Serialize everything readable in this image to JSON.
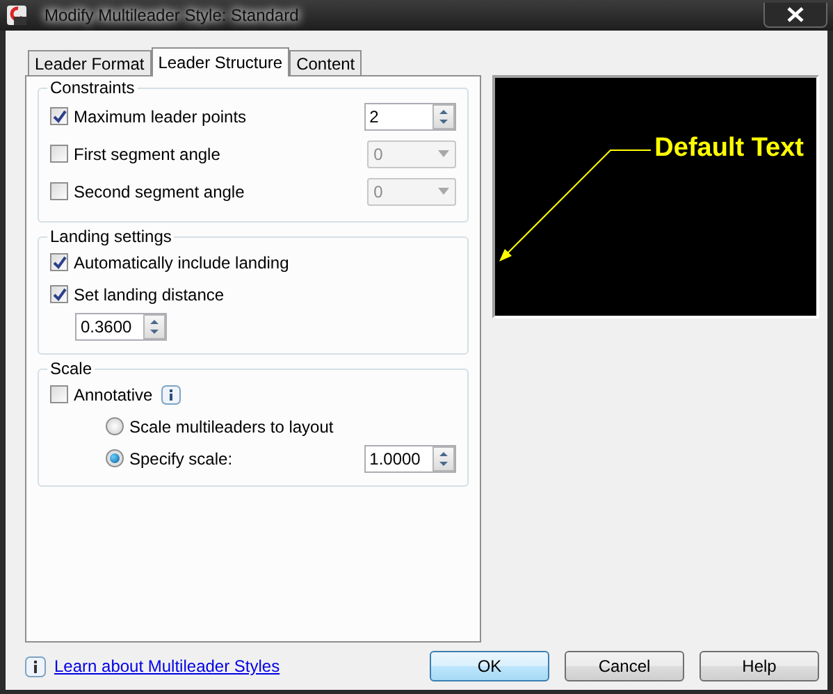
{
  "window": {
    "title": "Modify Multileader Style: Standard"
  },
  "tabs": [
    {
      "label": "Leader Format",
      "selected": false
    },
    {
      "label": "Leader Structure",
      "selected": true
    },
    {
      "label": "Content",
      "selected": false
    }
  ],
  "groups": [
    {
      "title": "Constraints",
      "items": [
        {
          "kind": "checkbox",
          "label": "Maximum leader points",
          "checked": true,
          "spinner": "2"
        },
        {
          "kind": "checkbox",
          "label": "First segment angle",
          "checked": false,
          "combo": {
            "value": "0",
            "disabled": true
          }
        },
        {
          "kind": "checkbox",
          "label": "Second segment angle",
          "checked": false,
          "combo": {
            "value": "0",
            "disabled": true
          }
        }
      ]
    },
    {
      "title": "Landing settings",
      "items": [
        {
          "kind": "checkbox",
          "label": "Automatically include landing",
          "checked": true
        },
        {
          "kind": "checkbox",
          "label": "Set landing distance",
          "checked": true
        },
        {
          "kind": "spinner",
          "value": "0.3600"
        }
      ]
    },
    {
      "title": "Scale",
      "items": [
        {
          "kind": "checkbox",
          "label": "Annotative",
          "checked": false,
          "info": true
        },
        {
          "kind": "radio",
          "label": "Scale multileaders to layout",
          "selected": false
        },
        {
          "kind": "radio",
          "label": "Specify scale:",
          "selected": true,
          "spinner": "1.0000"
        }
      ]
    }
  ],
  "preview": {
    "text": "Default Text"
  },
  "footer": {
    "link": "Learn about Multileader Styles",
    "buttons": [
      {
        "label": "OK",
        "default": true
      },
      {
        "label": "Cancel",
        "default": false
      },
      {
        "label": "Help",
        "default": false
      }
    ]
  }
}
